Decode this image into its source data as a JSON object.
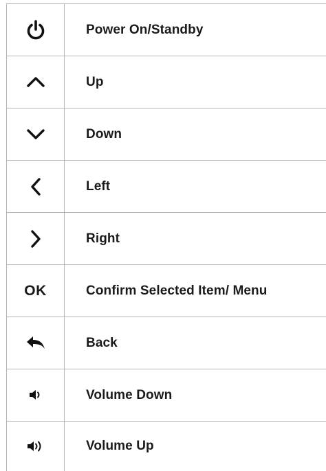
{
  "rows": [
    {
      "icon": "power-icon",
      "label": "Power On/Standby"
    },
    {
      "icon": "chevron-up-icon",
      "label": "Up"
    },
    {
      "icon": "chevron-down-icon",
      "label": "Down"
    },
    {
      "icon": "chevron-left-icon",
      "label": "Left"
    },
    {
      "icon": "chevron-right-icon",
      "label": "Right"
    },
    {
      "icon": "ok-text",
      "icon_text": "OK",
      "label": "Confirm Selected Item/ Menu"
    },
    {
      "icon": "back-arrow-icon",
      "label": "Back"
    },
    {
      "icon": "volume-down-icon",
      "label": "Volume Down"
    },
    {
      "icon": "volume-up-icon",
      "label": "Volume Up"
    }
  ]
}
